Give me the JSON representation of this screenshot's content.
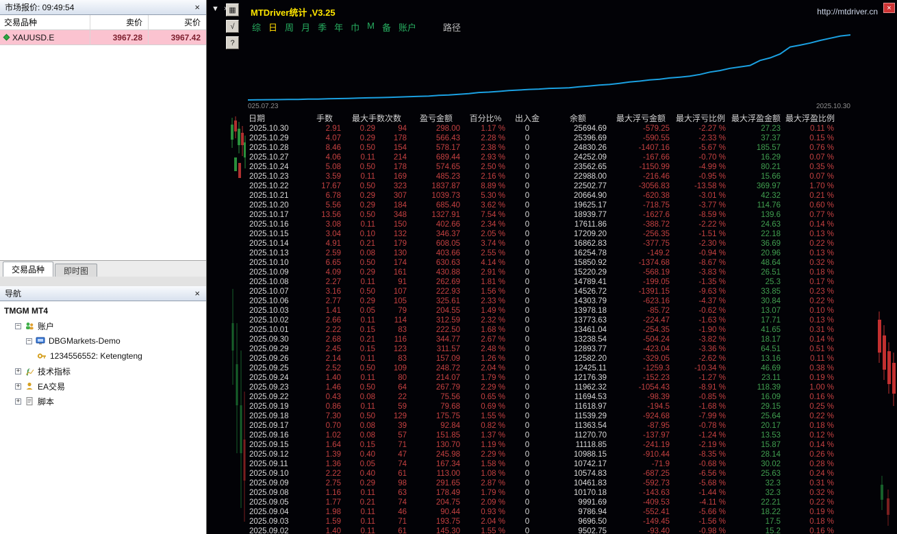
{
  "colors": {
    "curve_blue": "#1ba1e2",
    "value_red": "#c54141",
    "value_green": "#41a050",
    "title_yellow": "#ffe600",
    "toolbar_green": "#27ae60",
    "symbol_row_pink": "#fbc3d0"
  },
  "market_watch": {
    "title": "市场报价: 09:49:54",
    "close_glyph": "×",
    "columns": [
      "交易品种",
      "卖价",
      "买价"
    ],
    "rows": [
      {
        "symbol": "XAUUSD.E",
        "bid": "3967.28",
        "ask": "3967.42"
      }
    ],
    "tabs": [
      {
        "label": "交易品种",
        "active": true
      },
      {
        "label": "即时图",
        "active": false
      }
    ]
  },
  "navigator": {
    "title": "导航",
    "close_glyph": "×",
    "tree": [
      {
        "label": "TMGM MT4",
        "level": 0,
        "bold": true,
        "icon": null,
        "expand": null
      },
      {
        "label": "账户",
        "level": 1,
        "bold": false,
        "icon": "accounts",
        "expand": "minus"
      },
      {
        "label": "DBGMarkets-Demo",
        "level": 2,
        "bold": false,
        "icon": "server",
        "expand": "minus"
      },
      {
        "label": "1234556552: Ketengteng",
        "level": 3,
        "bold": false,
        "icon": "key",
        "expand": null
      },
      {
        "label": "技术指标",
        "level": 1,
        "bold": false,
        "icon": "indicator",
        "expand": "plus"
      },
      {
        "label": "EA交易",
        "level": 1,
        "bold": false,
        "icon": "expert",
        "expand": "plus"
      },
      {
        "label": "脚本",
        "level": 1,
        "bold": false,
        "icon": "script",
        "expand": "plus"
      }
    ]
  },
  "main_window": {
    "collapse_glyph": "▼",
    "close_glyph": "×|",
    "red_close_glyph": "×",
    "side_buttons": [
      {
        "name": "snapshot-button",
        "glyph": "▦"
      },
      {
        "name": "check-button",
        "glyph": "√"
      },
      {
        "name": "help-button",
        "glyph": "?"
      }
    ]
  },
  "stats": {
    "title": "MTDriver统计 ,V3.25",
    "url": "http://mtdriver.cn",
    "toolbar": [
      {
        "label": "综",
        "state": "normal"
      },
      {
        "label": "日",
        "state": "selected"
      },
      {
        "label": "周",
        "state": "normal"
      },
      {
        "label": "月",
        "state": "normal"
      },
      {
        "label": "季",
        "state": "normal"
      },
      {
        "label": "年",
        "state": "normal"
      },
      {
        "label": "巾",
        "state": "normal"
      },
      {
        "label": "M",
        "state": "normal"
      },
      {
        "label": "备",
        "state": "normal"
      },
      {
        "label": "账户",
        "state": "normal"
      },
      {
        "label": "路径",
        "state": "muted"
      }
    ],
    "chart": {
      "type": "line",
      "start_label": "025.07.23",
      "end_label": "2025.10.30",
      "y_min": 7400,
      "y_max": 26600,
      "values": [
        8493,
        8520,
        8555,
        8580,
        8610,
        8640,
        8700,
        8730,
        8790,
        8850,
        8910,
        8970,
        9040,
        9110,
        9180,
        9260,
        9340,
        9420,
        9502,
        9696,
        9787,
        9992,
        10170,
        10462,
        10575,
        10742,
        10988,
        11119,
        11271,
        11364,
        11539,
        11619,
        11695,
        11962,
        12176,
        12425,
        12582,
        12894,
        13239,
        13461,
        13774,
        13978,
        14304,
        14527,
        14789,
        15220,
        15851,
        16255,
        16863,
        17209,
        17612,
        18940,
        19625,
        20665,
        22503,
        22988,
        23563,
        24252,
        24830,
        25397,
        25695
      ]
    },
    "table": {
      "headers": [
        "日期",
        "手数",
        "最大手数次数",
        "盈亏金额",
        "百分比%",
        "出入金",
        "余额",
        "最大浮亏金额",
        "最大浮亏比例",
        "最大浮盈金额",
        "最大浮盈比例"
      ],
      "rows": [
        [
          "2025.10.30",
          "2.91",
          "0.29",
          "94",
          "298.00",
          "1.17 %",
          "0",
          "25694.69",
          "-579.25",
          "-2.27 %",
          "27.23",
          "0.11 %"
        ],
        [
          "2025.10.29",
          "4.07",
          "0.29",
          "178",
          "566.43",
          "2.28 %",
          "0",
          "25396.69",
          "-590.55",
          "-2.33 %",
          "37.37",
          "0.15 %"
        ],
        [
          "2025.10.28",
          "8.46",
          "0.50",
          "154",
          "578.17",
          "2.38 %",
          "0",
          "24830.26",
          "-1407.16",
          "-5.67 %",
          "185.57",
          "0.76 %"
        ],
        [
          "2025.10.27",
          "4.06",
          "0.11",
          "214",
          "689.44",
          "2.93 %",
          "0",
          "24252.09",
          "-167.66",
          "-0.70 %",
          "16.29",
          "0.07 %"
        ],
        [
          "2025.10.24",
          "5.08",
          "0.50",
          "178",
          "574.65",
          "2.50 %",
          "0",
          "23562.65",
          "-1150.99",
          "-4.99 %",
          "80.21",
          "0.35 %"
        ],
        [
          "2025.10.23",
          "3.59",
          "0.11",
          "169",
          "485.23",
          "2.16 %",
          "0",
          "22988.00",
          "-216.46",
          "-0.95 %",
          "15.66",
          "0.07 %"
        ],
        [
          "2025.10.22",
          "17.67",
          "0.50",
          "323",
          "1837.87",
          "8.89 %",
          "0",
          "22502.77",
          "-3056.83",
          "-13.58 %",
          "369.97",
          "1.70 %"
        ],
        [
          "2025.10.21",
          "6.78",
          "0.29",
          "307",
          "1039.73",
          "5.30 %",
          "0",
          "20664.90",
          "-620.38",
          "-3.01 %",
          "42.32",
          "0.21 %"
        ],
        [
          "2025.10.20",
          "5.56",
          "0.29",
          "184",
          "685.40",
          "3.62 %",
          "0",
          "19625.17",
          "-718.75",
          "-3.77 %",
          "114.76",
          "0.60 %"
        ],
        [
          "2025.10.17",
          "13.56",
          "0.50",
          "348",
          "1327.91",
          "7.54 %",
          "0",
          "18939.77",
          "-1627.6",
          "-8.59 %",
          "139.6",
          "0.77 %"
        ],
        [
          "2025.10.16",
          "3.08",
          "0.11",
          "150",
          "402.66",
          "2.34 %",
          "0",
          "17611.86",
          "-388.72",
          "-2.22 %",
          "24.63",
          "0.14 %"
        ],
        [
          "2025.10.15",
          "3.04",
          "0.10",
          "132",
          "346.37",
          "2.05 %",
          "0",
          "17209.20",
          "-256.35",
          "-1.51 %",
          "22.18",
          "0.13 %"
        ],
        [
          "2025.10.14",
          "4.91",
          "0.21",
          "179",
          "608.05",
          "3.74 %",
          "0",
          "16862.83",
          "-377.75",
          "-2.30 %",
          "36.69",
          "0.22 %"
        ],
        [
          "2025.10.13",
          "2.59",
          "0.08",
          "130",
          "403.66",
          "2.55 %",
          "0",
          "16254.78",
          "-149.2",
          "-0.94 %",
          "20.96",
          "0.13 %"
        ],
        [
          "2025.10.10",
          "6.65",
          "0.50",
          "174",
          "630.63",
          "4.14 %",
          "0",
          "15850.92",
          "-1374.68",
          "-8.67 %",
          "48.64",
          "0.32 %"
        ],
        [
          "2025.10.09",
          "4.09",
          "0.29",
          "161",
          "430.88",
          "2.91 %",
          "0",
          "15220.29",
          "-568.19",
          "-3.83 %",
          "26.51",
          "0.18 %"
        ],
        [
          "2025.10.08",
          "2.27",
          "0.11",
          "91",
          "262.69",
          "1.81 %",
          "0",
          "14789.41",
          "-199.05",
          "-1.35 %",
          "25.3",
          "0.17 %"
        ],
        [
          "2025.10.07",
          "3.16",
          "0.50",
          "107",
          "222.93",
          "1.56 %",
          "0",
          "14526.72",
          "-1391.15",
          "-9.63 %",
          "33.85",
          "0.23 %"
        ],
        [
          "2025.10.06",
          "2.77",
          "0.29",
          "105",
          "325.61",
          "2.33 %",
          "0",
          "14303.79",
          "-623.16",
          "-4.37 %",
          "30.84",
          "0.22 %"
        ],
        [
          "2025.10.03",
          "1.41",
          "0.05",
          "79",
          "204.55",
          "1.49 %",
          "0",
          "13978.18",
          "-85.72",
          "-0.62 %",
          "13.07",
          "0.10 %"
        ],
        [
          "2025.10.02",
          "2.66",
          "0.11",
          "114",
          "312.59",
          "2.32 %",
          "0",
          "13773.63",
          "-224.47",
          "-1.63 %",
          "17.71",
          "0.13 %"
        ],
        [
          "2025.10.01",
          "2.22",
          "0.15",
          "83",
          "222.50",
          "1.68 %",
          "0",
          "13461.04",
          "-254.35",
          "-1.90 %",
          "41.65",
          "0.31 %"
        ],
        [
          "2025.09.30",
          "2.68",
          "0.21",
          "116",
          "344.77",
          "2.67 %",
          "0",
          "13238.54",
          "-504.24",
          "-3.82 %",
          "18.17",
          "0.14 %"
        ],
        [
          "2025.09.29",
          "2.45",
          "0.15",
          "123",
          "311.57",
          "2.48 %",
          "0",
          "12893.77",
          "-423.04",
          "-3.36 %",
          "64.51",
          "0.51 %"
        ],
        [
          "2025.09.26",
          "2.14",
          "0.11",
          "83",
          "157.09",
          "1.26 %",
          "0",
          "12582.20",
          "-329.05",
          "-2.62 %",
          "13.16",
          "0.11 %"
        ],
        [
          "2025.09.25",
          "2.52",
          "0.50",
          "109",
          "248.72",
          "2.04 %",
          "0",
          "12425.11",
          "-1259.3",
          "-10.34 %",
          "46.69",
          "0.38 %"
        ],
        [
          "2025.09.24",
          "1.40",
          "0.11",
          "80",
          "214.07",
          "1.79 %",
          "0",
          "12176.39",
          "-152.23",
          "-1.27 %",
          "23.11",
          "0.19 %"
        ],
        [
          "2025.09.23",
          "1.46",
          "0.50",
          "64",
          "267.79",
          "2.29 %",
          "0",
          "11962.32",
          "-1054.43",
          "-8.91 %",
          "118.39",
          "1.00 %"
        ],
        [
          "2025.09.22",
          "0.43",
          "0.08",
          "22",
          "75.56",
          "0.65 %",
          "0",
          "11694.53",
          "-98.39",
          "-0.85 %",
          "16.09",
          "0.16 %"
        ],
        [
          "2025.09.19",
          "0.86",
          "0.11",
          "59",
          "79.68",
          "0.69 %",
          "0",
          "11618.97",
          "-194.5",
          "-1.68 %",
          "29.15",
          "0.25 %"
        ],
        [
          "2025.09.18",
          "7.30",
          "0.50",
          "129",
          "175.75",
          "1.55 %",
          "0",
          "11539.29",
          "-924.68",
          "-7.99 %",
          "25.64",
          "0.22 %"
        ],
        [
          "2025.09.17",
          "0.70",
          "0.08",
          "39",
          "92.84",
          "0.82 %",
          "0",
          "11363.54",
          "-87.95",
          "-0.78 %",
          "20.17",
          "0.18 %"
        ],
        [
          "2025.09.16",
          "1.02",
          "0.08",
          "57",
          "151.85",
          "1.37 %",
          "0",
          "11270.70",
          "-137.97",
          "-1.24 %",
          "13.53",
          "0.12 %"
        ],
        [
          "2025.09.15",
          "1.64",
          "0.15",
          "71",
          "130.70",
          "1.19 %",
          "0",
          "11118.85",
          "-241.19",
          "-2.19 %",
          "15.87",
          "0.14 %"
        ],
        [
          "2025.09.12",
          "1.39",
          "0.40",
          "47",
          "245.98",
          "2.29 %",
          "0",
          "10988.15",
          "-910.44",
          "-8.35 %",
          "28.14",
          "0.26 %"
        ],
        [
          "2025.09.11",
          "1.36",
          "0.05",
          "74",
          "167.34",
          "1.58 %",
          "0",
          "10742.17",
          "-71.9",
          "-0.68 %",
          "30.02",
          "0.28 %"
        ],
        [
          "2025.09.10",
          "2.22",
          "0.40",
          "61",
          "113.00",
          "1.08 %",
          "0",
          "10574.83",
          "-687.25",
          "-6.56 %",
          "25.63",
          "0.24 %"
        ],
        [
          "2025.09.09",
          "2.75",
          "0.29",
          "98",
          "291.65",
          "2.87 %",
          "0",
          "10461.83",
          "-592.73",
          "-5.68 %",
          "32.3",
          "0.31 %"
        ],
        [
          "2025.09.08",
          "1.16",
          "0.11",
          "63",
          "178.49",
          "1.79 %",
          "0",
          "10170.18",
          "-143.63",
          "-1.44 %",
          "32.3",
          "0.32 %"
        ],
        [
          "2025.09.05",
          "1.77",
          "0.21",
          "74",
          "204.75",
          "2.09 %",
          "0",
          "9991.69",
          "-409.53",
          "-4.11 %",
          "22.21",
          "0.22 %"
        ],
        [
          "2025.09.04",
          "1.98",
          "0.11",
          "46",
          "90.44",
          "0.93 %",
          "0",
          "9786.94",
          "-552.41",
          "-5.66 %",
          "18.22",
          "0.19 %"
        ],
        [
          "2025.09.03",
          "1.59",
          "0.11",
          "71",
          "193.75",
          "2.04 %",
          "0",
          "9696.50",
          "-149.45",
          "-1.56 %",
          "17.5",
          "0.18 %"
        ],
        [
          "2025.09.02",
          "1.40",
          "0.11",
          "61",
          "145.30",
          "1.55 %",
          "0",
          "9502.75",
          "-93.40",
          "-0.98 %",
          "15.2",
          "0.16 %"
        ]
      ]
    }
  }
}
